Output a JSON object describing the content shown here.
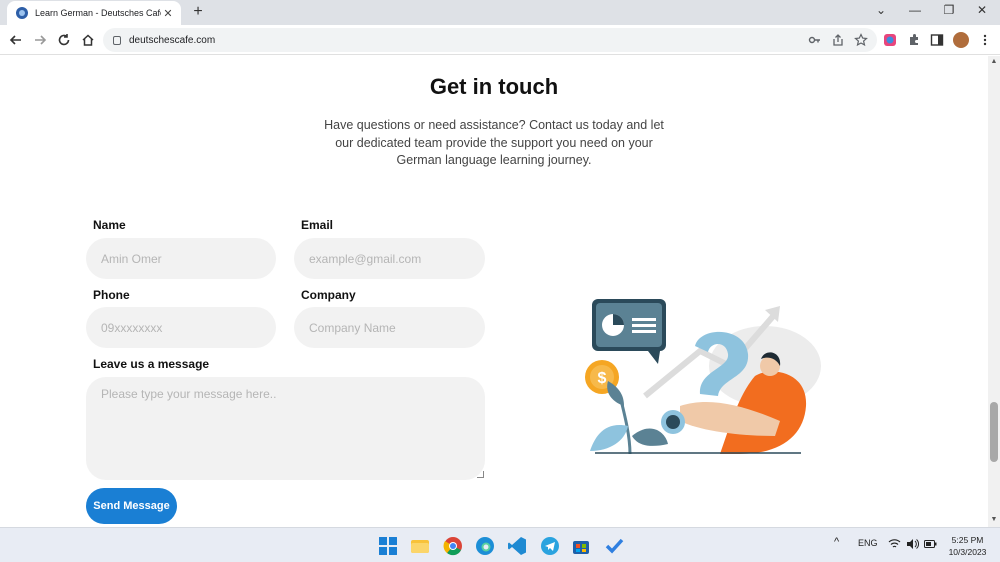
{
  "browser": {
    "tab_title": "Learn German - Deutsches Cafe",
    "tab_close": "✕",
    "new_tab": "+",
    "url": "deutschescafe.com",
    "window_controls": {
      "collapse": "⌄",
      "minimize": "—",
      "restore": "❐",
      "close": "✕"
    }
  },
  "section": {
    "heading": "Get in touch",
    "description": "Have questions or need assistance? Contact us today and let our dedicated team provide the support you need on your German language learning journey."
  },
  "form": {
    "name": {
      "label": "Name",
      "placeholder": "Amin Omer"
    },
    "email": {
      "label": "Email",
      "placeholder": "example@gmail.com"
    },
    "phone": {
      "label": "Phone",
      "placeholder": "09xxxxxxxx"
    },
    "company": {
      "label": "Company",
      "placeholder": "Company Name"
    },
    "message": {
      "label": "Leave us a message",
      "placeholder": "Please type your message here.."
    },
    "submit_label": "Send Message"
  },
  "colors": {
    "accent": "#1a7fd4",
    "field_bg": "#f2f2f2",
    "illustration_orange": "#f26d1f",
    "illustration_blue": "#8ec3de",
    "illustration_dark": "#2b4a5a",
    "coin": "#f5a623"
  },
  "taskbar": {
    "tray_chevron": "^",
    "language": "ENG",
    "time": "5:25 PM",
    "date": "10/3/2023"
  }
}
